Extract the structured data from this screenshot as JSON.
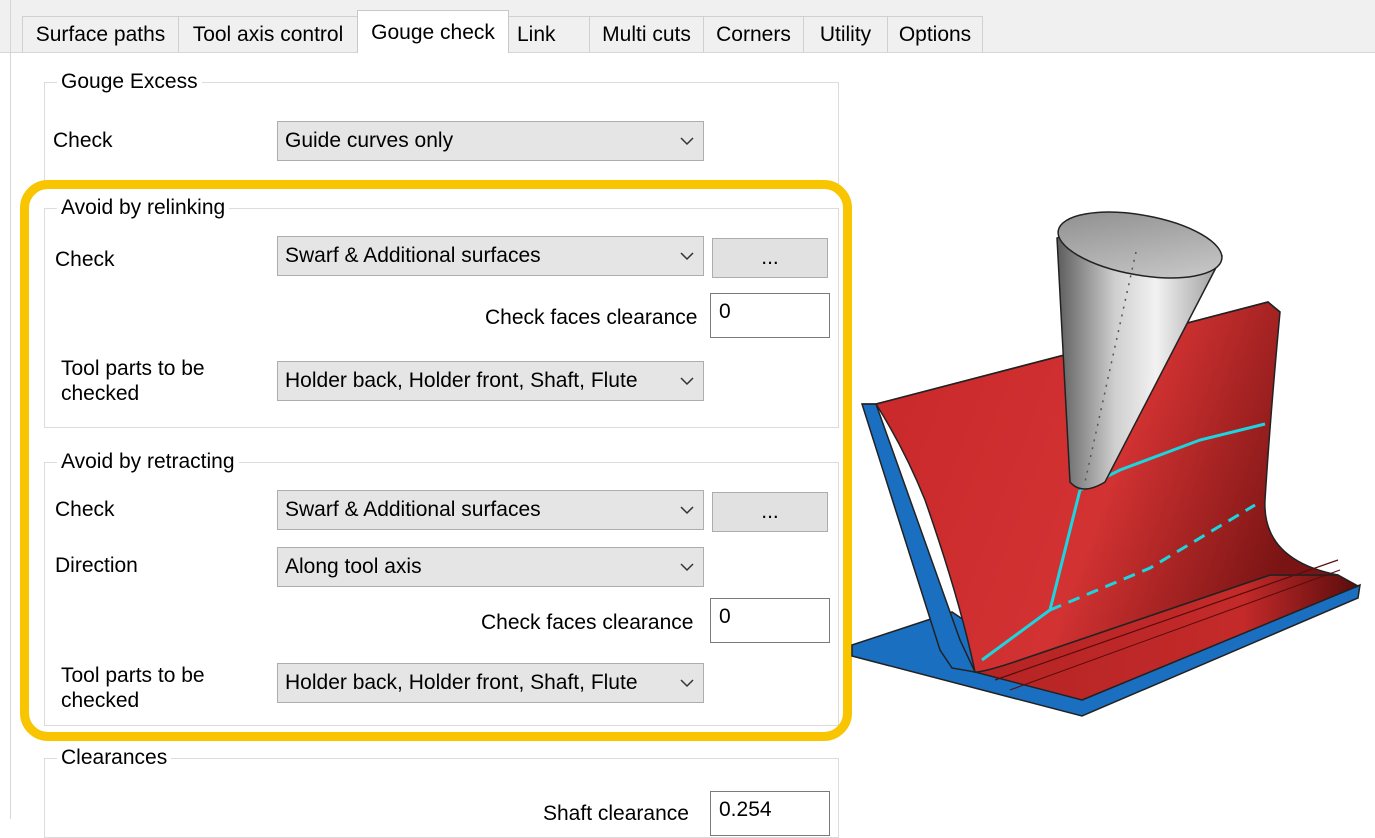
{
  "tabs": [
    "Surface paths",
    "Tool axis control",
    "Gouge check",
    "Link",
    "Multi cuts",
    "Corners",
    "Utility",
    "Options"
  ],
  "active_tab": "Gouge check",
  "gouge_excess": {
    "title": "Gouge Excess",
    "check_label": "Check",
    "check_value": "Guide curves only"
  },
  "relinking": {
    "title": "Avoid by relinking",
    "check_label": "Check",
    "check_value": "Swarf & Additional surfaces",
    "more_button": "...",
    "clearance_label": "Check faces clearance",
    "clearance_value": "0",
    "tool_parts_label": "Tool parts to be checked",
    "tool_parts_value": "Holder back, Holder front, Shaft, Flute"
  },
  "retracting": {
    "title": "Avoid by retracting",
    "check_label": "Check",
    "check_value": "Swarf & Additional surfaces",
    "more_button": "...",
    "direction_label": "Direction",
    "direction_value": "Along tool axis",
    "clearance_label": "Check faces clearance",
    "clearance_value": "0",
    "tool_parts_label": "Tool parts to be checked",
    "tool_parts_value": "Holder back, Holder front, Shaft, Flute"
  },
  "clearances": {
    "title": "Clearances",
    "shaft_label": "Shaft clearance",
    "shaft_value": "0.254"
  },
  "colors": {
    "highlight": "#f9c400",
    "surface_red": "#c8282a",
    "floor_blue": "#1a6fc0",
    "path_cyan": "#19d6e0",
    "tool_gray": "#9a9a9a"
  },
  "icons": [
    "chevron-down-icon"
  ]
}
